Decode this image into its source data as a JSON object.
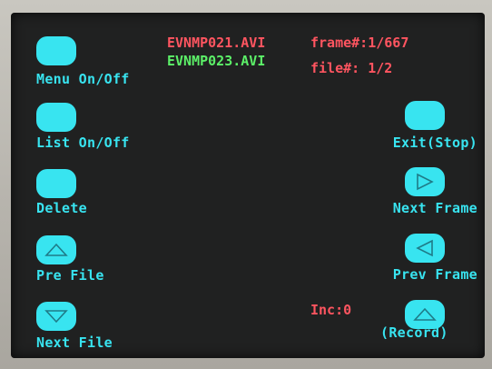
{
  "colors": {
    "accent": "#38e4f0",
    "info_red": "#ff5560",
    "info_green": "#5cf068",
    "screen_bg": "#202121"
  },
  "left_buttons": {
    "menu": {
      "label": "Menu On/Off"
    },
    "list": {
      "label": "List On/Off"
    },
    "delete": {
      "label": "Delete"
    },
    "pre_file": {
      "label": "Pre File",
      "icon": "triangle-up-icon"
    },
    "next_file": {
      "label": "Next File",
      "icon": "triangle-down-icon"
    }
  },
  "right_buttons": {
    "exit": {
      "label": "Exit(Stop)"
    },
    "next_frame": {
      "label": "Next Frame",
      "icon": "triangle-right-icon"
    },
    "prev_frame": {
      "label": "Prev Frame",
      "icon": "triangle-left-icon"
    },
    "record": {
      "label": "(Record)",
      "icon": "triangle-up-icon"
    }
  },
  "info": {
    "file_current": "EVNMP021.AVI",
    "file_next": "EVNMP023.AVI",
    "frame": "frame#:1/667",
    "file_count": "file#: 1/2",
    "inc": "Inc:0"
  }
}
